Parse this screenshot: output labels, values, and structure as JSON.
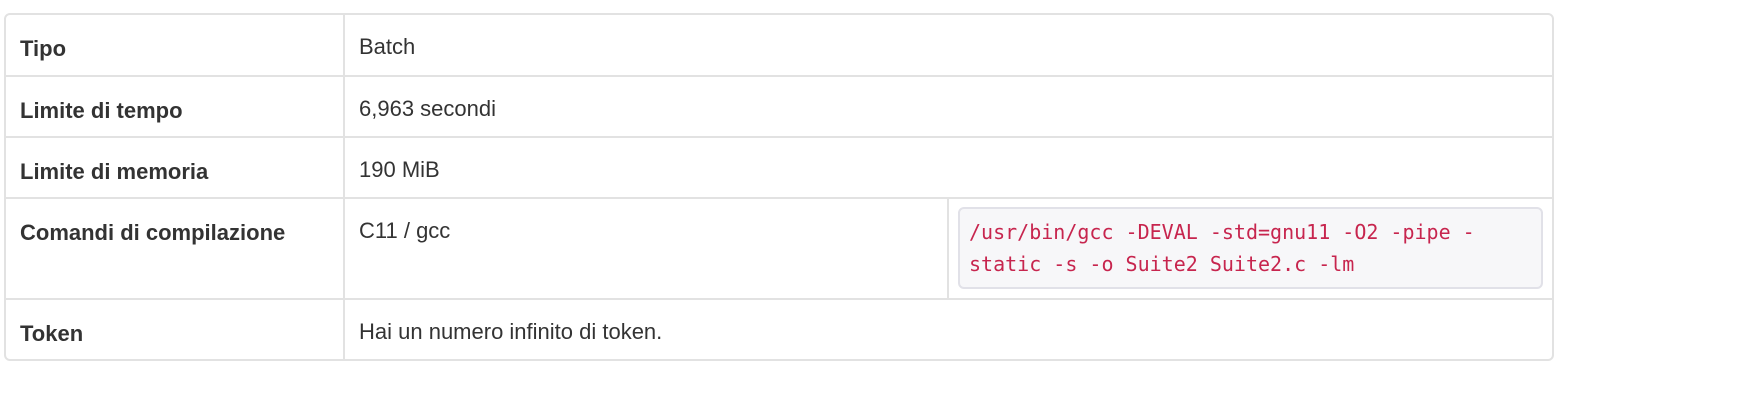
{
  "details": {
    "rows": [
      {
        "label": "Tipo",
        "value": "Batch"
      },
      {
        "label": "Limite di tempo",
        "value": "6,963 secondi"
      },
      {
        "label": "Limite di memoria",
        "value": "190 MiB"
      },
      {
        "label": "Comandi di compilazione",
        "language": "C11 / gcc",
        "command": "/usr/bin/gcc -DEVAL -std=gnu11 -O2 -pipe -static -s -o Suite2 Suite2.c -lm"
      },
      {
        "label": "Token",
        "value": "Hai un numero infinito di token."
      }
    ]
  },
  "colors": {
    "border": "#e2e2e2",
    "text": "#333333",
    "code_text": "#c7254e",
    "code_bg": "#f7f7f9",
    "code_border": "#e1e1e8"
  }
}
